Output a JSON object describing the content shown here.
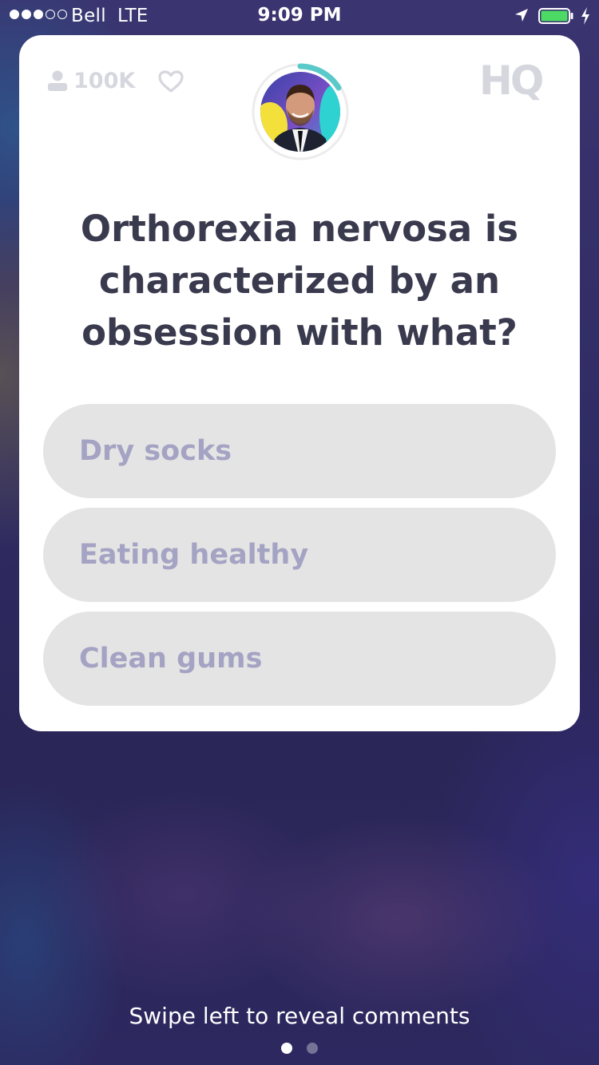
{
  "status_bar": {
    "signal_dots_filled": 3,
    "signal_dots_total": 5,
    "carrier": "Bell",
    "network": "LTE",
    "time": "9:09 PM",
    "battery_level": 1.0,
    "battery_color": "#4cd964",
    "charging": true
  },
  "header": {
    "viewer_icon": "person-icon",
    "viewer_count": "100K",
    "like_icon": "heart-outline-icon",
    "logo_text": "HQ",
    "logo_color": "#d6d6de",
    "timer_color": "#5ac9c9"
  },
  "question": {
    "text": "Orthorexia nervosa is characterized by an obsession with what?"
  },
  "answers": [
    {
      "label": "Dry socks"
    },
    {
      "label": "Eating healthy"
    },
    {
      "label": "Clean gums"
    }
  ],
  "footer": {
    "hint": "Swipe left to reveal comments",
    "pages": 2,
    "active_page": 1
  }
}
